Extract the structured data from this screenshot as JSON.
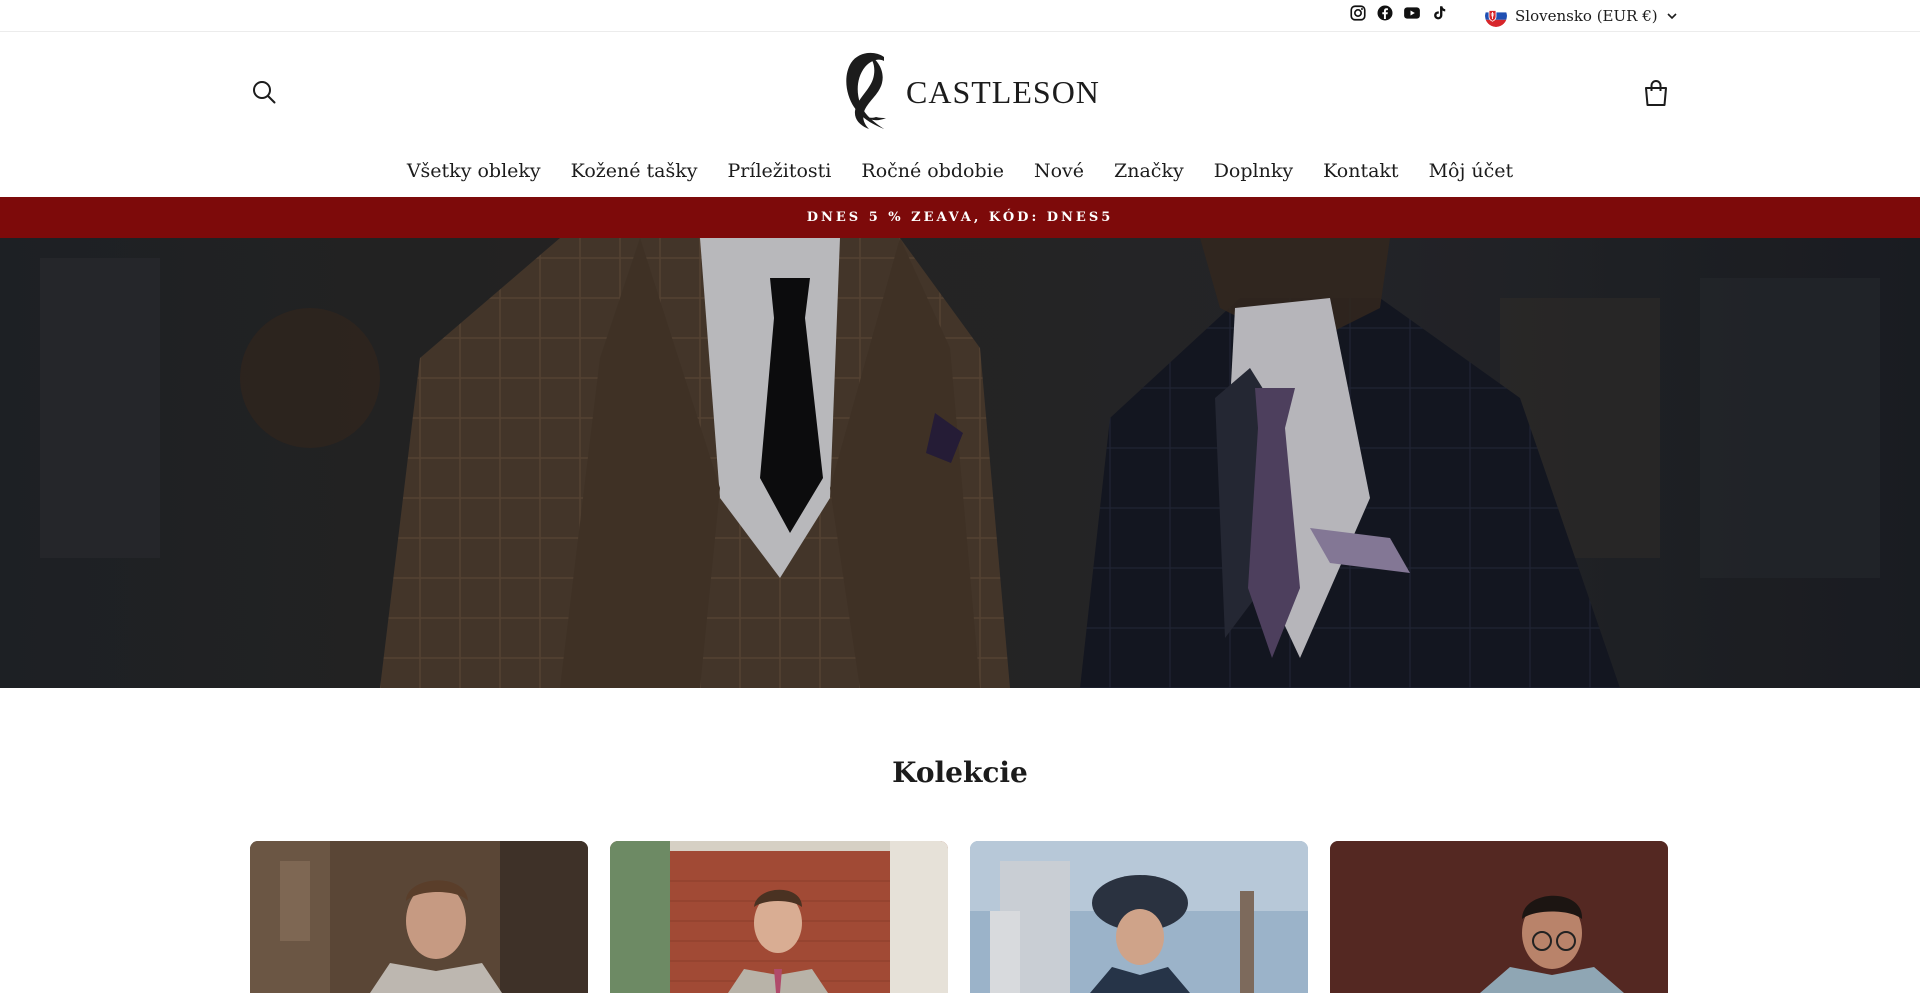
{
  "utility": {
    "social_icons": [
      "instagram-icon",
      "facebook-icon",
      "youtube-icon",
      "tiktok-icon"
    ],
    "locale_label": "Slovensko (EUR €)",
    "flag": "slovakia-flag-icon"
  },
  "header": {
    "brand": "CASTLESON",
    "search_icon": "search-icon",
    "cart_icon": "cart-icon"
  },
  "nav": {
    "items": [
      "Všetky obleky",
      "Kožené tašky",
      "Príležitosti",
      "Ročné obdobie",
      "Nové",
      "Značky",
      "Doplnky",
      "Kontakt",
      "Môj účet"
    ]
  },
  "announcement": {
    "text": "DNES 5 % ZEAVA, KÓD: DNES5"
  },
  "colors": {
    "announcement_bg": "#7d0a0a",
    "text": "#1c1c1c",
    "background": "#ffffff"
  },
  "collections": {
    "title": "Kolekcie"
  }
}
